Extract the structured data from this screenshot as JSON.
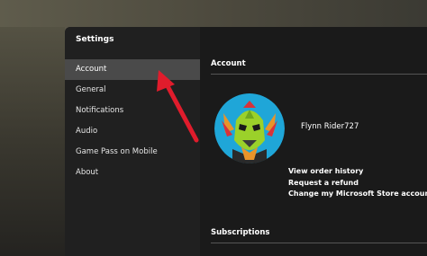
{
  "window": {
    "title": "Settings"
  },
  "sidebar": {
    "items": [
      {
        "label": "Account",
        "active": true
      },
      {
        "label": "General"
      },
      {
        "label": "Notifications"
      },
      {
        "label": "Audio"
      },
      {
        "label": "Game Pass on Mobile"
      },
      {
        "label": "About"
      }
    ]
  },
  "account": {
    "section_title": "Account",
    "username": "Flynn Rider727",
    "links": [
      "View order history",
      "Request a refund",
      "Change my Microsoft Store account"
    ]
  },
  "subscriptions": {
    "section_title": "Subscriptions"
  },
  "colors": {
    "sidebar_active": "#4a4a4a",
    "annotation_arrow": "#e01c2c",
    "avatar_bg": "#1fa6d8",
    "avatar_face": "#9bd12a"
  },
  "icons": {
    "avatar": "alien-avatar-icon",
    "annotation": "red-arrow-icon"
  }
}
